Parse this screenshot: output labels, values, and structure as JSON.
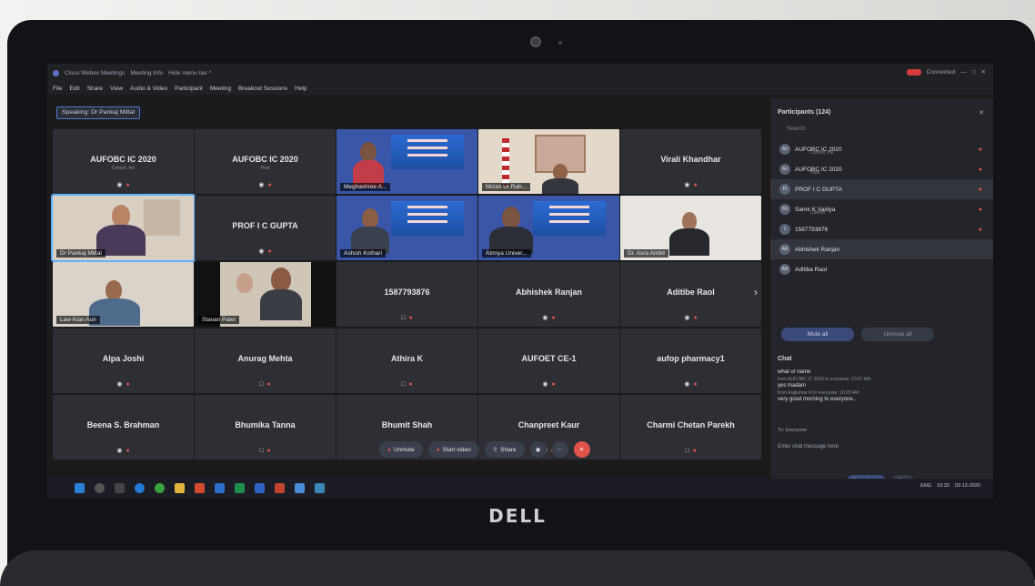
{
  "titlebar": {
    "app": "Cisco Webex Meetings",
    "info": "Meeting Info",
    "hide": "Hide menu bar ^",
    "connected": "Connected"
  },
  "menu": [
    "File",
    "Edit",
    "Share",
    "View",
    "Audio & Video",
    "Participant",
    "Meeting",
    "Breakout Sessions",
    "Help"
  ],
  "speaking": "Speaking: Dr Pankaj Mittal",
  "tiles": [
    {
      "name": "AUFOBC IC 2020",
      "sub": "Cohost, me",
      "kind": "text"
    },
    {
      "name": "AUFOBC IC 2020",
      "sub": "Host",
      "kind": "text"
    },
    {
      "name": "Meghashree A...",
      "kind": "video"
    },
    {
      "name": "Mizan Ur Rah...",
      "kind": "video"
    },
    {
      "name": "Virali Khandhar",
      "kind": "text"
    },
    {
      "name": "Dr Pankaj Mittal",
      "kind": "video"
    },
    {
      "name": "PROF I C GUPTA",
      "kind": "text"
    },
    {
      "name": "Ashish Kothari",
      "kind": "video"
    },
    {
      "name": "Atmiya Univer...",
      "kind": "video"
    },
    {
      "name": "Dr. Asra Amlid",
      "kind": "video"
    },
    {
      "name": "Law Kian Aun",
      "kind": "video"
    },
    {
      "name": "Stavan Patel",
      "kind": "video"
    },
    {
      "name": "1587793876",
      "kind": "text"
    },
    {
      "name": "Abhishek Ranjan",
      "kind": "text"
    },
    {
      "name": "Aditibe Raol",
      "kind": "text"
    },
    {
      "name": "Alpa Joshi",
      "kind": "text"
    },
    {
      "name": "Anurag Mehta",
      "kind": "text"
    },
    {
      "name": "Athira K",
      "kind": "text"
    },
    {
      "name": "AUFOET CE-1",
      "kind": "text"
    },
    {
      "name": "aufop pharmacy1",
      "kind": "text"
    },
    {
      "name": "Beena S. Brahman",
      "kind": "text"
    },
    {
      "name": "Bhumika Tanna",
      "kind": "text"
    },
    {
      "name": "Bhumit Shah",
      "kind": "text"
    },
    {
      "name": "Chanpreet Kaur",
      "kind": "text"
    },
    {
      "name": "Charmi Chetan Parekh",
      "kind": "text"
    }
  ],
  "participants": {
    "title": "Participants (124)",
    "search": "Search",
    "rows": [
      {
        "initials": "AJ",
        "name": "AUFOBC IC 2020",
        "role": "Cohost, me"
      },
      {
        "initials": "AJ",
        "name": "AUFOBC IC 2020",
        "role": "Host"
      },
      {
        "initials": "PI",
        "name": "PROF I C GUPTA",
        "role": ""
      },
      {
        "initials": "SV",
        "name": "Samir K Vaidya",
        "role": "Cohost"
      },
      {
        "initials": "1",
        "name": "1587793876",
        "role": ""
      },
      {
        "initials": "AR",
        "name": "Abhishek Ranjan",
        "role": ""
      },
      {
        "initials": "AR",
        "name": "Aditiba Raol",
        "role": ""
      }
    ],
    "mute_all": "Mute all",
    "unmute_all": "Unmute all"
  },
  "chat": {
    "title": "Chat",
    "messages": [
      {
        "text": "what ur name",
        "meta": ""
      },
      {
        "text": "",
        "meta": "from AUFOBC IC 2020 to everyone:   10:07 AM"
      },
      {
        "text": "yes madam",
        "meta": ""
      },
      {
        "text": "",
        "meta": "from Rajkumar R to everyone:   10:29 AM"
      },
      {
        "text": "very good morning to everyone..",
        "meta": ""
      }
    ],
    "to": "To:   Everyone",
    "placeholder": "Enter chat message here",
    "participants_btn": "Participants",
    "chat_btn": "Chat"
  },
  "controls": {
    "unmute": "Unmute",
    "start_video": "Start video",
    "share": "Share"
  },
  "tray": {
    "lang": "ENG",
    "time": "10:33",
    "date": "03-12-2020"
  },
  "brand": "DELL"
}
